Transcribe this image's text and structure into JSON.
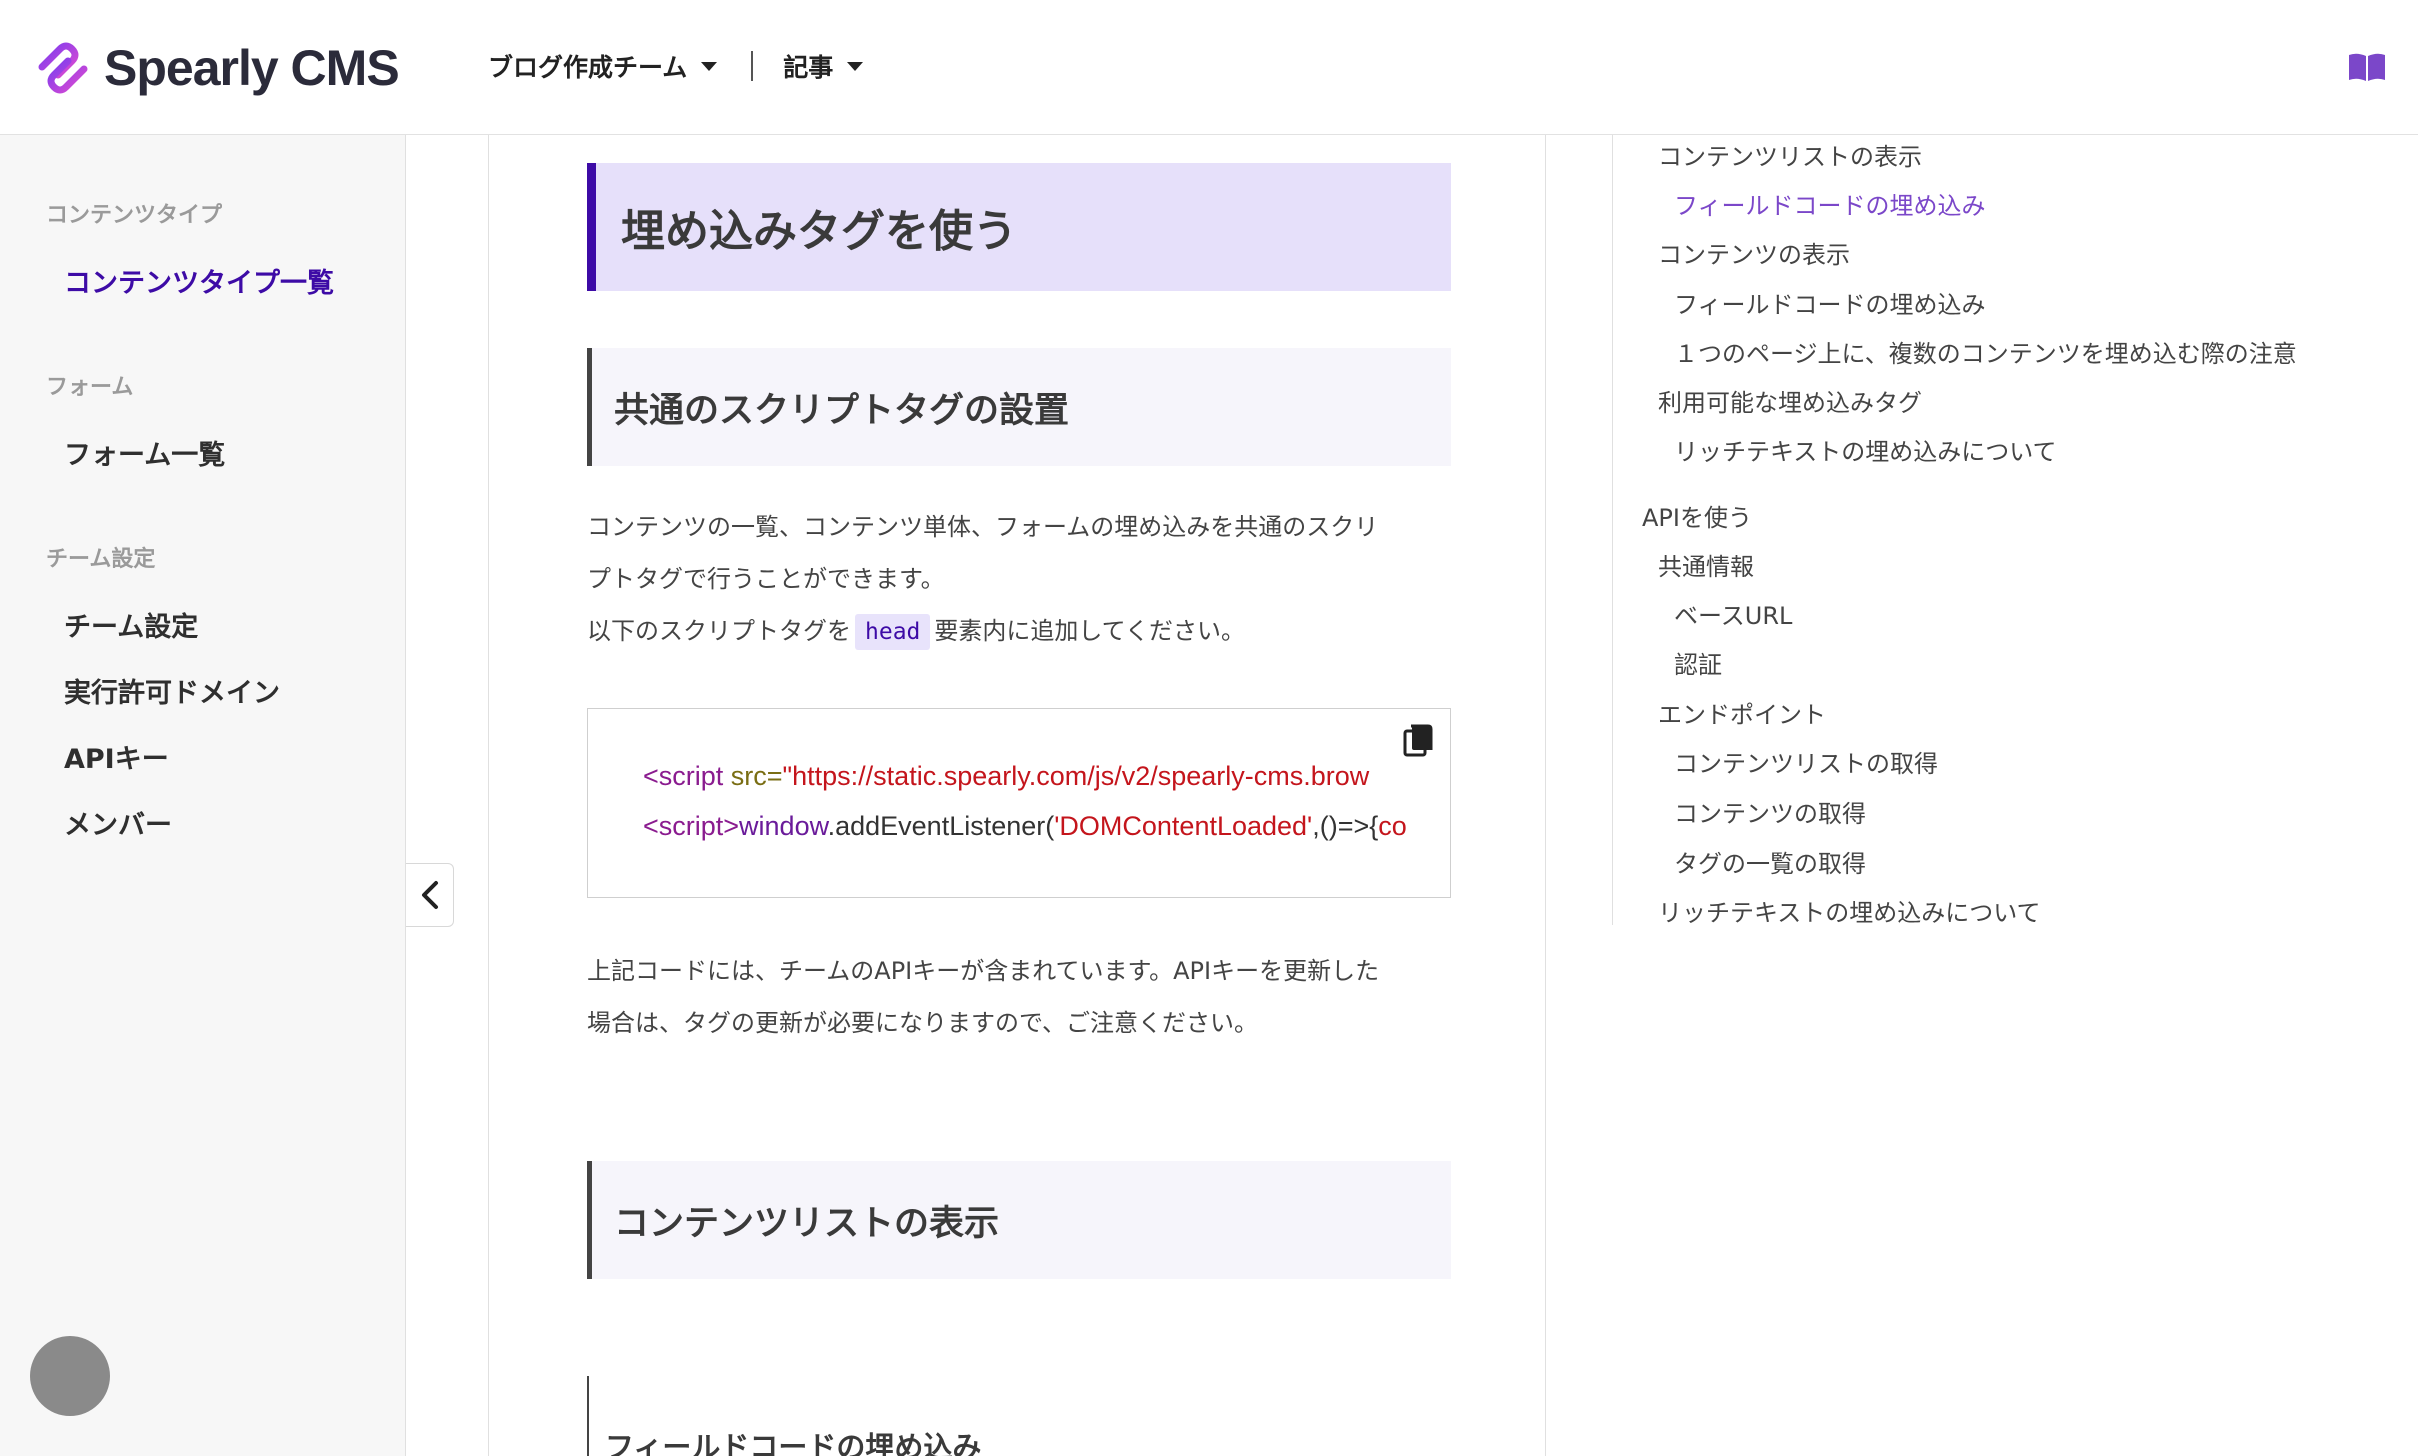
{
  "header": {
    "logo_text": "Spearly CMS",
    "team_menu": "ブログ作成チーム",
    "article_menu": "記事",
    "docs_icon": "book-icon",
    "brand_color": "#3d0ba6"
  },
  "sidebar": {
    "sections": [
      {
        "category": "コンテンツタイプ",
        "items": [
          "コンテンツタイプ一覧"
        ]
      },
      {
        "category": "フォーム",
        "items": [
          "フォーム一覧"
        ]
      },
      {
        "category": "チーム設定",
        "items": [
          "チーム設定",
          "実行許可ドメイン",
          "APIキー",
          "メンバー"
        ]
      }
    ],
    "active_item": "コンテンツタイプ一覧",
    "collapse_icon": "chevron-left-icon"
  },
  "article": {
    "h1": "埋め込みタグを使う",
    "h2_script": "共通のスクリプトタグの設置",
    "para1_line1": "コンテンツの一覧、コンテンツ単体、フォームの埋め込みを共通のスクリ",
    "para1_line2": "プトタグで行うことができます。",
    "para1_line3_before": "以下のスクリプトタグを",
    "para1_line3_code": "head",
    "para1_line3_after": "要素内に追加してください。",
    "code": {
      "line1_tag": "<script",
      "line1_attr": " src=",
      "line1_str": "\"https://static.spearly.com/js/v2/spearly-cms.brow",
      "line2_tag": "<script>",
      "line2_obj": "window",
      "line2_plain1": ".addEventListener(",
      "line2_str": "'DOMContentLoaded'",
      "line2_plain2": ",()=>{",
      "line2_tail": "co",
      "copy_icon": "copy-icon"
    },
    "para2_line1": "上記コードには、チームのAPIキーが含まれています。APIキーを更新した",
    "para2_line2": "場合は、タグの更新が必要になりますので、ご注意ください。",
    "h2_list": "コンテンツリストの表示",
    "h3_field": "フィールドコードの埋め込み"
  },
  "toc": {
    "items": [
      {
        "label": "コンテンツリストの表示",
        "level": 2
      },
      {
        "label": "フィールドコードの埋め込み",
        "level": 3,
        "active": true
      },
      {
        "label": "コンテンツの表示",
        "level": 2
      },
      {
        "label": "フィールドコードの埋め込み",
        "level": 3
      },
      {
        "label": "１つのページ上に、複数のコンテンツを埋め込む際の注意",
        "level": 3
      },
      {
        "label": "利用可能な埋め込みタグ",
        "level": 2
      },
      {
        "label": "リッチテキストの埋め込みについて",
        "level": 3
      },
      {
        "label": "APIを使う",
        "level": 1
      },
      {
        "label": "共通情報",
        "level": 2
      },
      {
        "label": "ベースURL",
        "level": 3
      },
      {
        "label": "認証",
        "level": 3
      },
      {
        "label": "エンドポイント",
        "level": 2
      },
      {
        "label": "コンテンツリストの取得",
        "level": 3
      },
      {
        "label": "コンテンツの取得",
        "level": 3
      },
      {
        "label": "タグの一覧の取得",
        "level": 3
      },
      {
        "label": "リッチテキストの埋め込みについて",
        "level": 2
      }
    ],
    "active_color": "#7b47c9"
  }
}
